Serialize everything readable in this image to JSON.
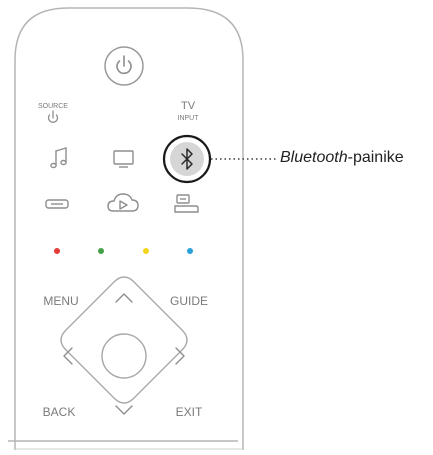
{
  "remote": {
    "labels": {
      "source": "SOURCE",
      "tv": "TV",
      "input": "INPUT",
      "menu": "MENU",
      "guide": "GUIDE",
      "back": "BACK",
      "exit": "EXIT"
    },
    "color_buttons": [
      "#e53935",
      "#43a047",
      "#f1d41c",
      "#2a9fd8"
    ],
    "icons": {
      "power": "power-icon",
      "source_power": "small-power-icon",
      "music": "music-note-icon",
      "tv": "tv-screen-icon",
      "bluetooth": "bluetooth-icon",
      "device": "set-top-box-icon",
      "cloud": "cloud-play-icon",
      "game": "game-console-icon"
    }
  },
  "callout": {
    "italic": "Bluetooth",
    "rest": "-painike"
  }
}
